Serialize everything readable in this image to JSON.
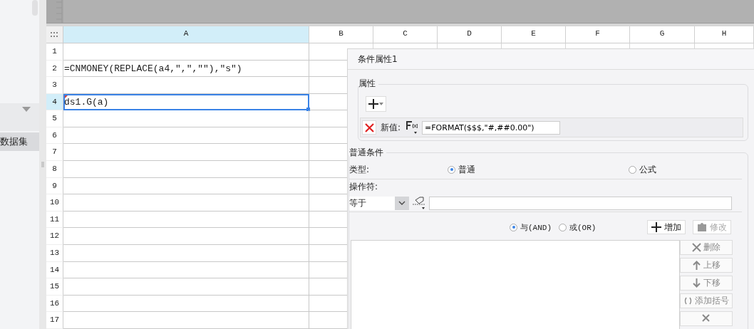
{
  "sidebar": {
    "items": [
      {
        "label": "数据集",
        "selected": true
      }
    ]
  },
  "sheet": {
    "columns": [
      {
        "label": "A",
        "selected": true
      },
      {
        "label": "B",
        "selected": false
      },
      {
        "label": "C",
        "selected": false
      },
      {
        "label": "D",
        "selected": false
      },
      {
        "label": "E",
        "selected": false
      },
      {
        "label": "F",
        "selected": false
      },
      {
        "label": "G",
        "selected": false
      },
      {
        "label": "H",
        "selected": false
      }
    ],
    "rows": [
      {
        "number": "1",
        "selected": false
      },
      {
        "number": "2",
        "selected": false,
        "value": "=CNMONEY(REPLACE(a4,\",\",\"\"),\"s\")"
      },
      {
        "number": "3",
        "selected": false
      },
      {
        "number": "4",
        "selected": true,
        "value": "ds1.G(a)"
      },
      {
        "number": "5",
        "selected": false
      },
      {
        "number": "6",
        "selected": false
      },
      {
        "number": "7",
        "selected": false
      },
      {
        "number": "8",
        "selected": false
      },
      {
        "number": "9",
        "selected": false
      },
      {
        "number": "10",
        "selected": false
      },
      {
        "number": "11",
        "selected": false
      },
      {
        "number": "12",
        "selected": false
      },
      {
        "number": "13",
        "selected": false
      },
      {
        "number": "14",
        "selected": false
      },
      {
        "number": "15",
        "selected": false
      },
      {
        "number": "16",
        "selected": false
      },
      {
        "number": "17",
        "selected": false
      }
    ]
  },
  "dialog": {
    "title": "条件属性1",
    "attributes": {
      "title": "属性",
      "entries": [
        {
          "label": "新值:",
          "value": "=FORMAT($$$,\"#,##0.00\")"
        }
      ]
    },
    "condition": {
      "title": "普通条件",
      "type_label": "类型:",
      "type_options": [
        {
          "label": "普通",
          "selected": true
        },
        {
          "label": "公式",
          "selected": false
        }
      ],
      "operator_label": "操作符:",
      "operator": "等于",
      "joins": [
        {
          "label": "与(AND)",
          "selected": true
        },
        {
          "label": "或(OR)",
          "selected": false
        }
      ],
      "actions": [
        {
          "kind": "add",
          "label": "增加",
          "disabled": false
        },
        {
          "kind": "edit",
          "label": "修改",
          "disabled": true
        }
      ],
      "side_buttons": [
        {
          "kind": "delete",
          "label": "删除",
          "disabled": true
        },
        {
          "kind": "up",
          "label": "上移",
          "disabled": true
        },
        {
          "kind": "down",
          "label": "下移",
          "disabled": true
        },
        {
          "kind": "brackets",
          "label": "添加括号",
          "disabled": true
        },
        {
          "kind": "unbracket",
          "disabled": true
        }
      ]
    }
  }
}
